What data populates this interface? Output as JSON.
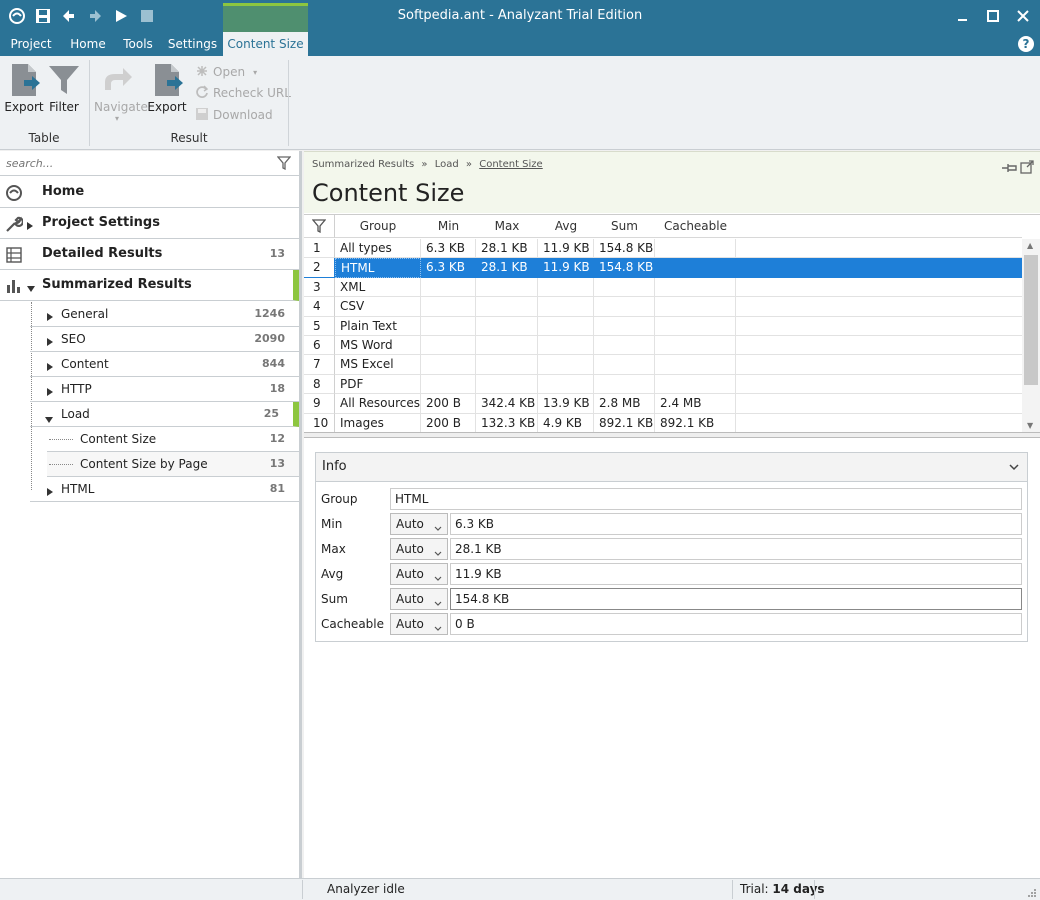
{
  "window": {
    "title": "Softpedia.ant - Analyzant Trial Edition"
  },
  "menu": {
    "tabs": [
      "Project",
      "Home",
      "Tools",
      "Settings",
      "Content Size"
    ],
    "help": "?"
  },
  "ribbon": {
    "export_table": "Export",
    "filter": "Filter",
    "group_table": "Table",
    "navigate": "Navigate",
    "export_result": "Export",
    "open": "Open",
    "recheck_url": "Recheck URL",
    "download": "Download",
    "group_result": "Result"
  },
  "sidebar": {
    "search_placeholder": "search...",
    "home": "Home",
    "project_settings": "Project Settings",
    "detailed_results": {
      "label": "Detailed Results",
      "count": "13"
    },
    "summarized_results": "Summarized Results",
    "items": [
      {
        "label": "General",
        "count": "1246"
      },
      {
        "label": "SEO",
        "count": "2090"
      },
      {
        "label": "Content",
        "count": "844"
      },
      {
        "label": "HTTP",
        "count": "18"
      },
      {
        "label": "Load",
        "count": "25"
      }
    ],
    "load_children": [
      {
        "label": "Content Size",
        "count": "12"
      },
      {
        "label": "Content Size by Page",
        "count": "13"
      }
    ],
    "html": {
      "label": "HTML",
      "count": "81"
    }
  },
  "breadcrumb": {
    "a": "Summarized Results",
    "b": "Load",
    "c": "Content Size",
    "sep": "»"
  },
  "page_title": "Content Size",
  "table": {
    "columns": [
      "Group",
      "Min",
      "Max",
      "Avg",
      "Sum",
      "Cacheable"
    ],
    "rows": [
      [
        "1",
        "All types",
        "6.3 KB",
        "28.1 KB",
        "11.9 KB",
        "154.8 KB",
        ""
      ],
      [
        "2",
        "HTML",
        "6.3 KB",
        "28.1 KB",
        "11.9 KB",
        "154.8 KB",
        ""
      ],
      [
        "3",
        "XML",
        "",
        "",
        "",
        "",
        ""
      ],
      [
        "4",
        "CSV",
        "",
        "",
        "",
        "",
        ""
      ],
      [
        "5",
        "Plain Text",
        "",
        "",
        "",
        "",
        ""
      ],
      [
        "6",
        "MS Word",
        "",
        "",
        "",
        "",
        ""
      ],
      [
        "7",
        "MS Excel",
        "",
        "",
        "",
        "",
        ""
      ],
      [
        "8",
        "PDF",
        "",
        "",
        "",
        "",
        ""
      ],
      [
        "9",
        "All Resources",
        "200 B",
        "342.4 KB",
        "13.9 KB",
        "2.8 MB",
        "2.4 MB"
      ],
      [
        "10",
        "Images",
        "200 B",
        "132.3 KB",
        "4.9 KB",
        "892.1 KB",
        "892.1 KB"
      ]
    ]
  },
  "info": {
    "title": "Info",
    "group_label": "Group",
    "group_value": "HTML",
    "rows": [
      {
        "label": "Min",
        "mode": "Auto",
        "value": "6.3 KB"
      },
      {
        "label": "Max",
        "mode": "Auto",
        "value": "28.1 KB"
      },
      {
        "label": "Avg",
        "mode": "Auto",
        "value": "11.9 KB"
      },
      {
        "label": "Sum",
        "mode": "Auto",
        "value": "154.8 KB"
      },
      {
        "label": "Cacheable",
        "mode": "Auto",
        "value": "0 B"
      }
    ]
  },
  "status": {
    "state": "Analyzer idle",
    "trial_prefix": "Trial: ",
    "trial_days": "14 days"
  },
  "colors": {
    "titlebar": "#2b7396",
    "accent_green": "#8dc63f",
    "selection": "#1e7fd8"
  }
}
